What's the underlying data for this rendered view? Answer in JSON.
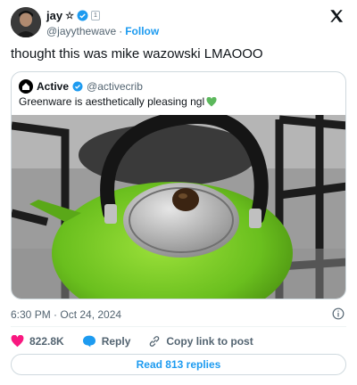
{
  "author": {
    "name": "jay",
    "handle": "@jayythewave",
    "separator": "·",
    "follow_label": "Follow",
    "box_badge": "1"
  },
  "tweet": {
    "text": "thought this was mike wazowski LMAOOO"
  },
  "quoted": {
    "name": "Active",
    "handle": "@activecrib",
    "text": "Greenware is aesthetically pleasing ngl"
  },
  "meta": {
    "timestamp": "6:30 PM · Oct 24, 2024"
  },
  "actions": {
    "likes": "822.8K",
    "reply_label": "Reply",
    "copy_label": "Copy link to post",
    "read_replies": "Read 813 replies"
  },
  "colors": {
    "accent": "#1d9bf0",
    "like": "#f91880",
    "verified": "#1d9bf0",
    "kettle_green": "#6abf1e"
  },
  "icons": {
    "brand": "x-logo-icon",
    "verified": "verified-badge-icon",
    "info": "info-icon",
    "like": "heart-icon",
    "reply": "speech-bubble-icon",
    "copy": "link-icon",
    "heart_emoji": "green-heart-icon"
  }
}
